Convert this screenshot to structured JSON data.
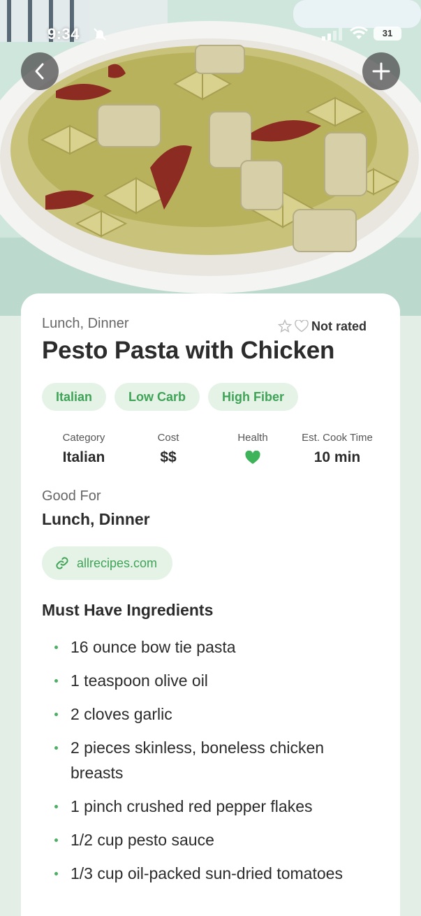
{
  "status_bar": {
    "time": "9:34",
    "battery": "31"
  },
  "hero": {
    "image_icon": "pasta-photo"
  },
  "nav": {
    "back_icon": "chevron-left-icon",
    "add_icon": "plus-icon"
  },
  "recipe": {
    "meal_types": "Lunch, Dinner",
    "rating_text": "Not rated",
    "title": "Pesto Pasta with Chicken",
    "tags": [
      "Italian",
      "Low Carb",
      "High Fiber"
    ],
    "stats": [
      {
        "label": "Category",
        "value": "Italian"
      },
      {
        "label": "Cost",
        "value": "$$"
      },
      {
        "label": "Health",
        "value": "",
        "icon": "heart-icon"
      },
      {
        "label": "Est. Cook Time",
        "value": "10 min"
      }
    ],
    "good_for_label": "Good For",
    "good_for_value": "Lunch, Dinner",
    "source": "allrecipes.com",
    "ingredients_title": "Must Have Ingredients",
    "ingredients": [
      "16 ounce bow tie pasta",
      "1 teaspoon olive oil",
      "2 cloves garlic",
      "2 pieces skinless, boneless chicken breasts",
      "1 pinch crushed red pepper flakes",
      "1/2 cup pesto sauce",
      "1/3 cup oil-packed sun-dried tomatoes"
    ]
  },
  "colors": {
    "accent_green": "#3fa357",
    "tag_bg": "#e5f3e7",
    "page_bg": "#e3efe6"
  }
}
